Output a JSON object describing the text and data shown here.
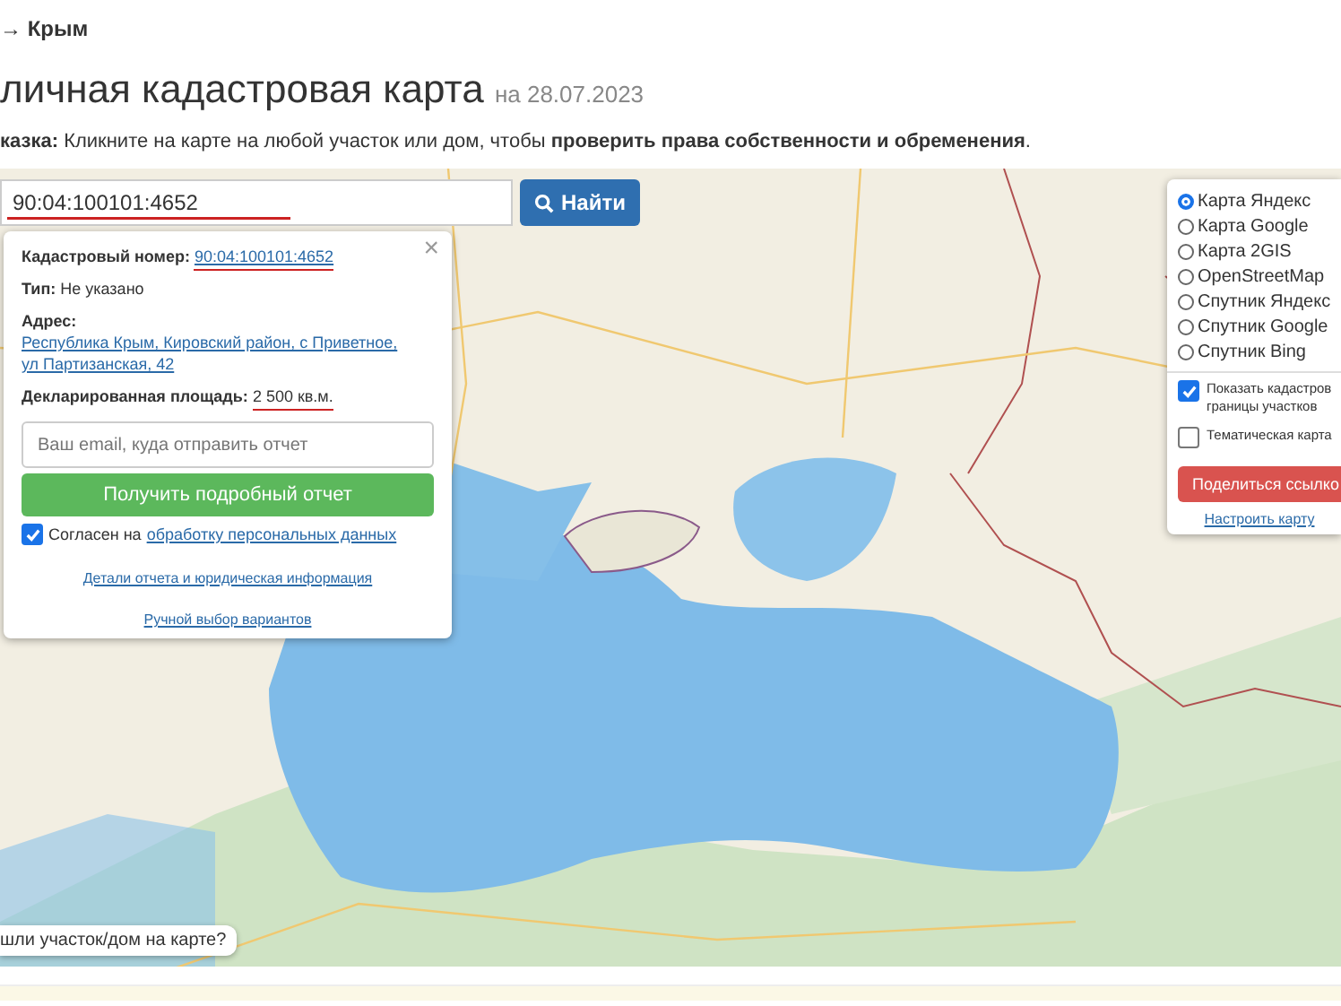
{
  "breadcrumb": "→ Крым",
  "title": {
    "main": "личная кадастровая карта",
    "date": "на 28.07.2023"
  },
  "hint": "**казка:** Кликните на карте на любой участок или дом, чтобы **проверить права собственности и обременения**.",
  "search": {
    "value": "90:04:100101:4652",
    "button": "Найти"
  },
  "popup": {
    "close": "×",
    "fields": [
      {
        "kind": "link",
        "label": "Кадастровый номер:",
        "value": "90:04:100101:4652"
      },
      {
        "kind": "text",
        "label": "Тип:",
        "value": "Не указано"
      },
      {
        "kind": "link",
        "label": "Адрес:",
        "value": "Республика Крым, Кировский район, с Приветное, ул Партизанская, 42"
      },
      {
        "kind": "text",
        "label": "Декларированная площадь:",
        "value": "2 500 кв.м."
      }
    ],
    "email": {
      "placeholder": "Ваш email, куда отправить отчет"
    },
    "submit": "Получить подробный отчет",
    "consent": {
      "checked": true,
      "text": "Согласен на",
      "link": "обработку персональных данных"
    },
    "details_link": "Детали отчета и юридическая информация",
    "manual_link": "Ручной выбор вариантов"
  },
  "layers": {
    "options": [
      {
        "label": "Карта Яндекс",
        "selected": true
      },
      {
        "label": "Карта Google",
        "selected": false
      },
      {
        "label": "Карта 2GIS",
        "selected": false
      },
      {
        "label": "OpenStreetMap",
        "selected": false
      },
      {
        "label": "Спутник Яндекс",
        "selected": false
      },
      {
        "label": "Спутник Google",
        "selected": false
      },
      {
        "label": "Спутник Bing",
        "selected": false
      }
    ],
    "toggles": [
      {
        "label": "Показать кадастров границы участков",
        "checked": true
      },
      {
        "label": "Тематическая карта",
        "checked": false
      }
    ],
    "share": "Поделиться ссылко",
    "settings_link": "Настроить карту"
  },
  "help_bubble": "шли участок/дом на карте?"
}
